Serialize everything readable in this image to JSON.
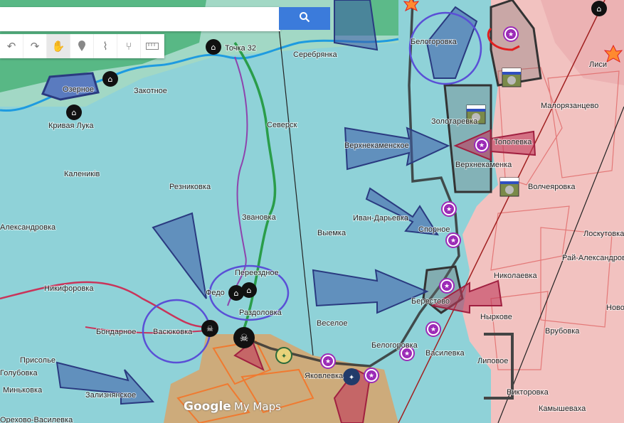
{
  "search": {
    "placeholder": "",
    "button_icon": "search-icon"
  },
  "toolbar": {
    "tools": [
      "undo-icon",
      "redo-icon",
      "hand-icon",
      "marker-icon",
      "line-icon",
      "route-icon",
      "ruler-icon"
    ]
  },
  "logo": {
    "google": "Google",
    "product": "My Maps"
  },
  "colors": {
    "ukraine": "#8fd2d8",
    "russia": "#f2c2c0",
    "green": "#3fa76a",
    "violet": "#8e44ad",
    "arrow_blue": "#3d5aa8",
    "arrow_red": "#c0395a",
    "icon_purple": "#9c2bb7"
  },
  "places": {
    "tochka32": "Точка 32",
    "serebryanka": "Серебрянка",
    "belogorovka_n": "Белогоровка",
    "ozernoe": "Озерное",
    "zakotnoe": "Закотное",
    "krivaya_luka": "Кривая Лука",
    "seversk": "Северск",
    "verkhnekamenskoe": "Верхнекаменское",
    "zolotarevka": "Золотаревка",
    "topolevka": "Тополевка",
    "verkhnekamenka": "Верхнекаменка",
    "malorjazantsevo": "Малорязанцево",
    "volcheyarovka": "Волчеяровка",
    "kaleniki": "Калеників",
    "reznikovka": "Резниковка",
    "aleksandrovka": "Александровка",
    "zvanovka": "Звановка",
    "ivano_daryevka": "Иван-Дарьевка",
    "vyemka": "Выемка",
    "spornoe": "Спорное",
    "loskutovka": "Лоскутовка",
    "ray_aleksandrovka": "Рай-Александровка",
    "nikolaevka": "Николаевка",
    "nikiforovka": "Никифоровка",
    "pereezdnoe": "Переездное",
    "fedorovka": "Федо",
    "razdolovka": "Раздоловка",
    "berestovoe": "Берестово",
    "bondarnoe": "Бондарное",
    "vasyukovka": "Васюковка",
    "veseloe": "Веселое",
    "nyrkovo": "Ныркове",
    "vrubovka": "Врубовка",
    "novo": "Ново",
    "belogorovka_s": "Белогоровка",
    "vasilevka": "Василевка",
    "lipovoe": "Липовое",
    "prisolye": "Присолье",
    "golubovka": "Голубовка",
    "minkovka": "Миньковка",
    "zaliznyanskoe": "Зализнянское",
    "yakovlevka": "Яковлевка",
    "viktorovka": "Викторовка",
    "kamyshevakha": "Камышеваха",
    "lisi": "Лиси",
    "orekhovo": "Орехово-Василевка"
  }
}
